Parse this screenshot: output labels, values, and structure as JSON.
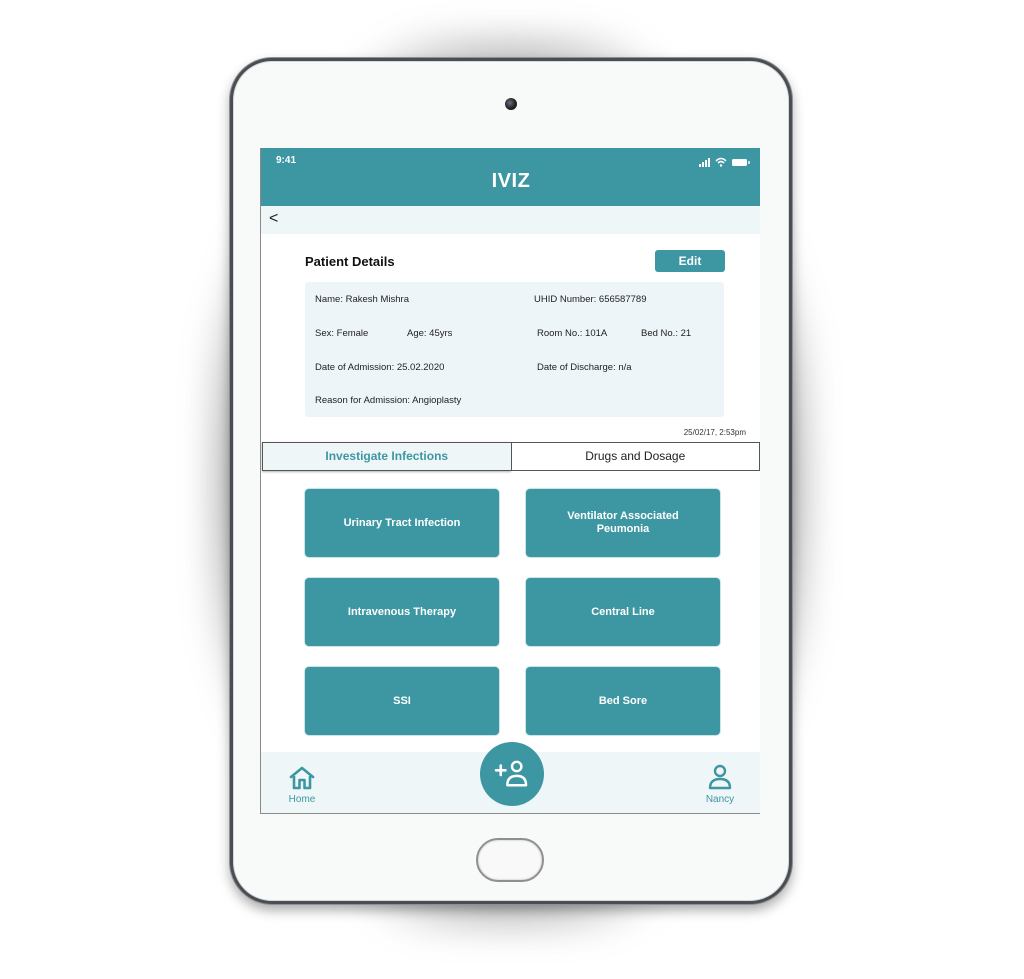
{
  "status_bar": {
    "time": "9:41"
  },
  "header": {
    "title": "IVIZ"
  },
  "nav": {
    "back_label": "<"
  },
  "patient": {
    "section_title": "Patient Details",
    "edit_label": "Edit",
    "name": "Name: Rakesh Mishra",
    "uhid": "UHID Number: 656587789",
    "sex": "Sex: Female",
    "age": "Age: 45yrs",
    "room": "Room No.: 101A",
    "bed": "Bed No.: 21",
    "admission_date": "Date of Admission: 25.02.2020",
    "discharge_date": "Date of Discharge: n/a",
    "reason": "Reason for Admission: Angioplasty"
  },
  "timestamp": "25/02/17, 2:53pm",
  "tabs": [
    {
      "label": "Investigate Infections",
      "active": true
    },
    {
      "label": "Drugs and Dosage",
      "active": false
    }
  ],
  "infections": [
    {
      "label": "Urinary Tract Infection"
    },
    {
      "label": "Ventilator Associated Peumonia"
    },
    {
      "label": "Intravenous Therapy"
    },
    {
      "label": "Central Line"
    },
    {
      "label": "SSI"
    },
    {
      "label": "Bed Sore"
    }
  ],
  "bottom_nav": {
    "home_label": "Home",
    "profile_label": "Nancy",
    "fab_icon": "add-user-icon"
  },
  "colors": {
    "accent": "#3d97a3",
    "light_panel": "#eef6f8"
  }
}
